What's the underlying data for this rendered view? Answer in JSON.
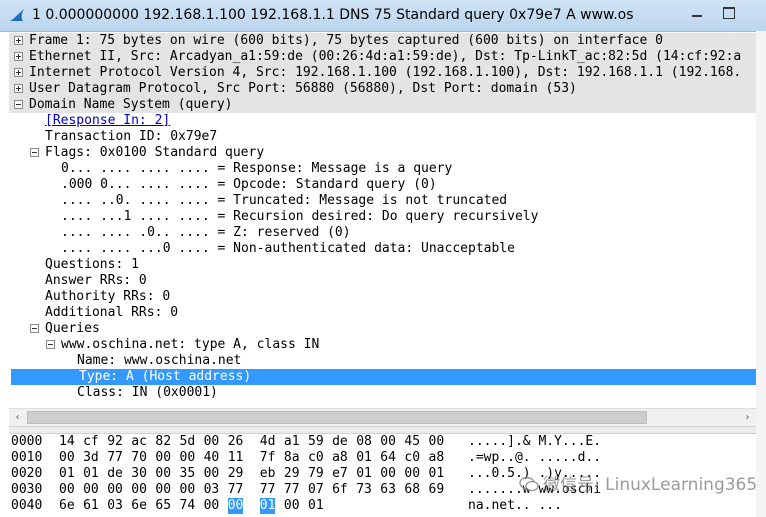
{
  "window": {
    "title": "1 0.000000000 192.168.1.100 192.168.1.1 DNS 75 Standard query 0x79e7  A www.os",
    "icon": "shark-fin-icon"
  },
  "tree": [
    {
      "text": "Frame 1: 75 bytes on wire (600 bits), 75 bytes captured (600 bits) on interface 0",
      "expander": "plus",
      "level": 0
    },
    {
      "text": "Ethernet II, Src: Arcadyan_a1:59:de (00:26:4d:a1:59:de), Dst: Tp-LinkT_ac:82:5d (14:cf:92:a",
      "expander": "plus",
      "level": 0
    },
    {
      "text": "Internet Protocol Version 4, Src: 192.168.1.100 (192.168.1.100), Dst: 192.168.1.1 (192.168.",
      "expander": "plus",
      "level": 0
    },
    {
      "text": "User Datagram Protocol, Src Port: 56880 (56880), Dst Port: domain (53)",
      "expander": "plus",
      "level": 0
    },
    {
      "text": "Domain Name System (query)",
      "expander": "minus",
      "level": 0
    },
    {
      "text": "[Response In: 2]",
      "expander": "",
      "level": 1,
      "link": true
    },
    {
      "text": "Transaction ID: 0x79e7",
      "expander": "",
      "level": 1
    },
    {
      "text": "Flags: 0x0100 Standard query",
      "expander": "minus",
      "level": 1
    },
    {
      "text": "0... .... .... .... = Response: Message is a query",
      "expander": "",
      "level": 2
    },
    {
      "text": ".000 0... .... .... = Opcode: Standard query (0)",
      "expander": "",
      "level": 2
    },
    {
      "text": ".... ..0. .... .... = Truncated: Message is not truncated",
      "expander": "",
      "level": 2
    },
    {
      "text": ".... ...1 .... .... = Recursion desired: Do query recursively",
      "expander": "",
      "level": 2
    },
    {
      "text": ".... .... .0.. .... = Z: reserved (0)",
      "expander": "",
      "level": 2
    },
    {
      "text": ".... .... ...0 .... = Non-authenticated data: Unacceptable",
      "expander": "",
      "level": 2
    },
    {
      "text": "Questions: 1",
      "expander": "",
      "level": 1
    },
    {
      "text": "Answer RRs: 0",
      "expander": "",
      "level": 1
    },
    {
      "text": "Authority RRs: 0",
      "expander": "",
      "level": 1
    },
    {
      "text": "Additional RRs: 0",
      "expander": "",
      "level": 1
    },
    {
      "text": "Queries",
      "expander": "minus",
      "level": 1
    },
    {
      "text": "www.oschina.net: type A, class IN",
      "expander": "minus",
      "level": 2
    },
    {
      "text": "Name: www.oschina.net",
      "expander": "",
      "level": 3
    },
    {
      "text": "Type: A (Host address)",
      "expander": "",
      "level": 3,
      "selected": true
    },
    {
      "text": "Class: IN (0x0001)",
      "expander": "",
      "level": 3
    }
  ],
  "hex_rows": [
    {
      "offset": "0000",
      "bytes": [
        "14",
        "cf",
        "92",
        "ac",
        "82",
        "5d",
        "00",
        "26",
        "4d",
        "a1",
        "59",
        "de",
        "08",
        "00",
        "45",
        "00"
      ],
      "ascii": ".....].& M.Y...E."
    },
    {
      "offset": "0010",
      "bytes": [
        "00",
        "3d",
        "77",
        "70",
        "00",
        "00",
        "40",
        "11",
        "7f",
        "8a",
        "c0",
        "a8",
        "01",
        "64",
        "c0",
        "a8"
      ],
      "ascii": ".=wp..@. .....d.."
    },
    {
      "offset": "0020",
      "bytes": [
        "01",
        "01",
        "de",
        "30",
        "00",
        "35",
        "00",
        "29",
        "eb",
        "29",
        "79",
        "e7",
        "01",
        "00",
        "00",
        "01"
      ],
      "ascii": "...0.5.) .)y....."
    },
    {
      "offset": "0030",
      "bytes": [
        "00",
        "00",
        "00",
        "00",
        "00",
        "00",
        "03",
        "77",
        "77",
        "77",
        "07",
        "6f",
        "73",
        "63",
        "68",
        "69"
      ],
      "ascii": ".......w ww.oschi"
    },
    {
      "offset": "0040",
      "bytes": [
        "6e",
        "61",
        "03",
        "6e",
        "65",
        "74",
        "00",
        "00",
        "01",
        "00",
        "01"
      ],
      "ascii": "na.net.. ..."
    }
  ],
  "hex_selection": {
    "row": 4,
    "byte_start": 7,
    "byte_end": 8
  },
  "scroll": {
    "left_arrow": "‹",
    "right_arrow": "›"
  },
  "watermark": {
    "text": "微信号: LinuxLearning365",
    "icon": "wechat-icon"
  },
  "colors": {
    "selection": "#3399ff",
    "link": "#0000cc",
    "highlight": "#e4e4e4"
  }
}
